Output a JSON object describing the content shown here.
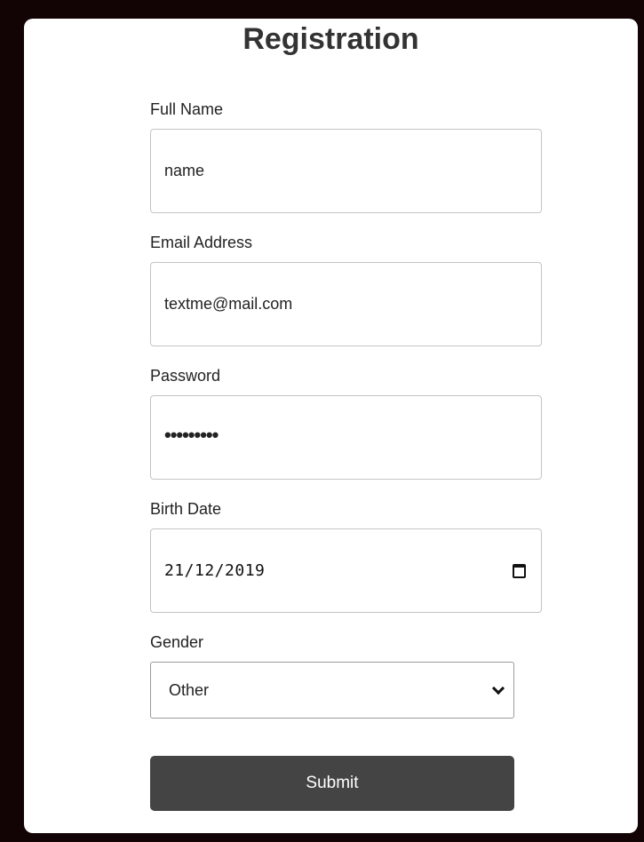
{
  "form": {
    "title": "Registration",
    "full_name": {
      "label": "Full Name",
      "value": "name"
    },
    "email": {
      "label": "Email Address",
      "value": "textme@mail.com"
    },
    "password": {
      "label": "Password",
      "masked_value": "•••••••••"
    },
    "birth_date": {
      "label": "Birth Date",
      "value": "21/12/2019",
      "icon": "calendar-icon"
    },
    "gender": {
      "label": "Gender",
      "selected": "Other",
      "icon": "chevron-down-icon"
    },
    "submit_label": "Submit"
  },
  "colors": {
    "page_background": "#120404",
    "card_background": "#ffffff",
    "button_background": "#444444",
    "button_text": "#ffffff",
    "title_text": "#333333"
  }
}
